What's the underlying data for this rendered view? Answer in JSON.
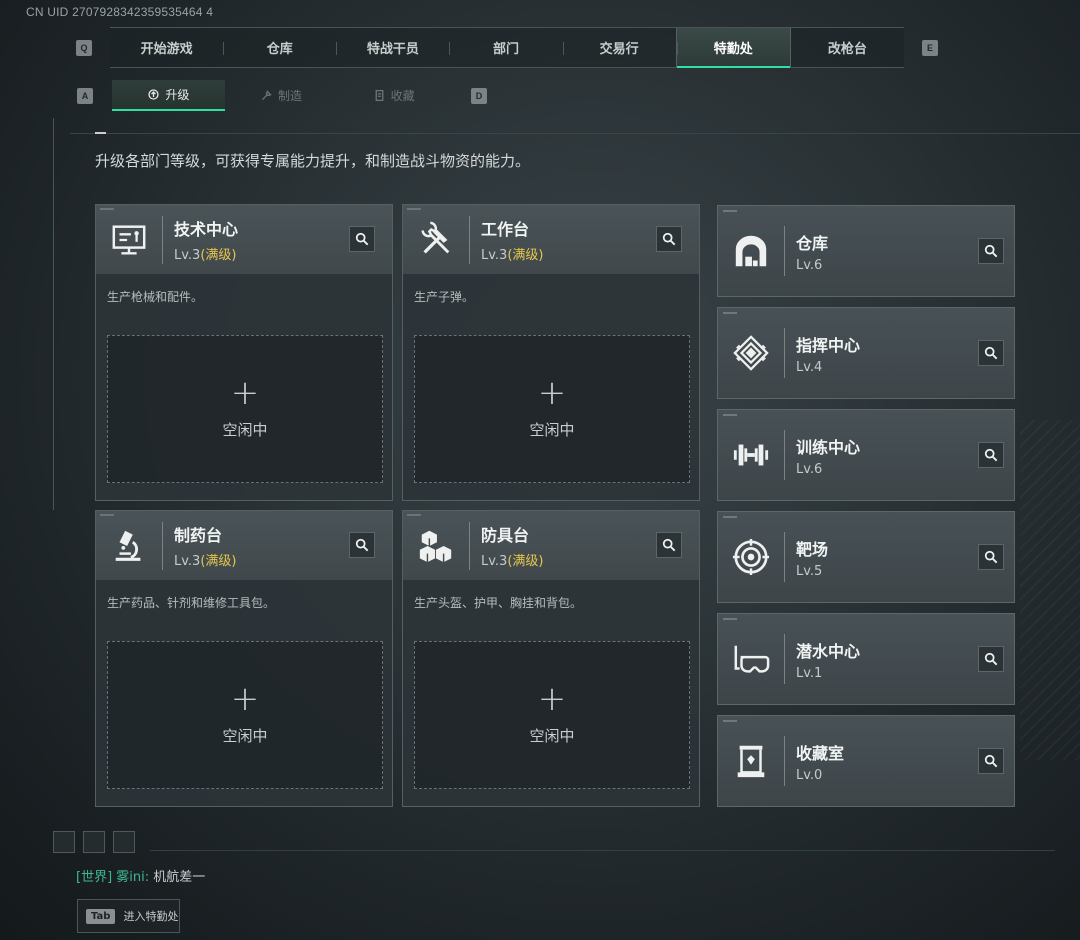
{
  "uid": "CN UID 2707928342359535464 4",
  "nav": {
    "left_key": "Q",
    "right_key": "E",
    "tabs": [
      {
        "label": "开始游戏",
        "active": false
      },
      {
        "label": "仓库",
        "active": false
      },
      {
        "label": "特战干员",
        "active": false
      },
      {
        "label": "部门",
        "active": false
      },
      {
        "label": "交易行",
        "active": false
      },
      {
        "label": "特勤处",
        "active": true
      },
      {
        "label": "改枪台",
        "active": false
      }
    ]
  },
  "subnav": {
    "left_key": "A",
    "right_key": "D",
    "tabs": [
      {
        "label": "升级",
        "icon": "upgrade-icon",
        "active": true
      },
      {
        "label": "制造",
        "icon": "craft-icon",
        "active": false
      },
      {
        "label": "收藏",
        "icon": "collection-icon",
        "active": false
      }
    ]
  },
  "description": "升级各部门等级，可获得专属能力提升，和制造战斗物资的能力。",
  "departments": [
    {
      "title": "技术中心",
      "level": "Lv.3",
      "maxed": "(满级)",
      "desc": "生产枪械和配件。",
      "slot_plus": "+",
      "slot_status": "空闲中",
      "icon": "computer-icon"
    },
    {
      "title": "工作台",
      "level": "Lv.3",
      "maxed": "(满级)",
      "desc": "生产子弹。",
      "slot_plus": "+",
      "slot_status": "空闲中",
      "icon": "tools-icon"
    },
    {
      "title": "制药台",
      "level": "Lv.3",
      "maxed": "(满级)",
      "desc": "生产药品、针剂和维修工具包。",
      "slot_plus": "+",
      "slot_status": "空闲中",
      "icon": "microscope-icon"
    },
    {
      "title": "防具台",
      "level": "Lv.3",
      "maxed": "(满级)",
      "desc": "生产头盔、护甲、胸挂和背包。",
      "slot_plus": "+",
      "slot_status": "空闲中",
      "icon": "boxes-icon"
    }
  ],
  "side_departments": [
    {
      "title": "仓库",
      "level": "Lv.6",
      "icon": "warehouse-icon"
    },
    {
      "title": "指挥中心",
      "level": "Lv.4",
      "icon": "command-icon"
    },
    {
      "title": "训练中心",
      "level": "Lv.6",
      "icon": "dumbbell-icon"
    },
    {
      "title": "靶场",
      "level": "Lv.5",
      "icon": "target-icon"
    },
    {
      "title": "潜水中心",
      "level": "Lv.1",
      "icon": "diving-mask-icon"
    },
    {
      "title": "收藏室",
      "level": "Lv.0",
      "icon": "display-case-icon"
    }
  ],
  "chat": {
    "channel": "[世界]",
    "name": "雾ini:",
    "message": "机航差一"
  },
  "tab_hint": {
    "key": "Tab",
    "label": "进入特勤处"
  }
}
